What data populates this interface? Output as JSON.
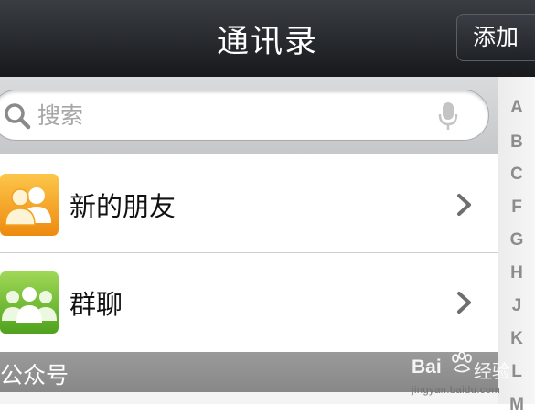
{
  "header": {
    "title": "通讯录",
    "add_label": "添加"
  },
  "search": {
    "placeholder": "搜索"
  },
  "index_letters": [
    "A",
    "B",
    "C",
    "F",
    "G",
    "H",
    "J",
    "K",
    "L",
    "M"
  ],
  "rows": [
    {
      "label": "新的朋友",
      "icon": "two-people-icon",
      "icon_color": "#f2a21c"
    },
    {
      "label": "群聊",
      "icon": "three-people-icon",
      "icon_color": "#6dbb2e"
    }
  ],
  "section": {
    "title": "公众号"
  },
  "watermark": {
    "brand": "Bai",
    "product": "经验",
    "url": "jingyan.baidu.com"
  }
}
